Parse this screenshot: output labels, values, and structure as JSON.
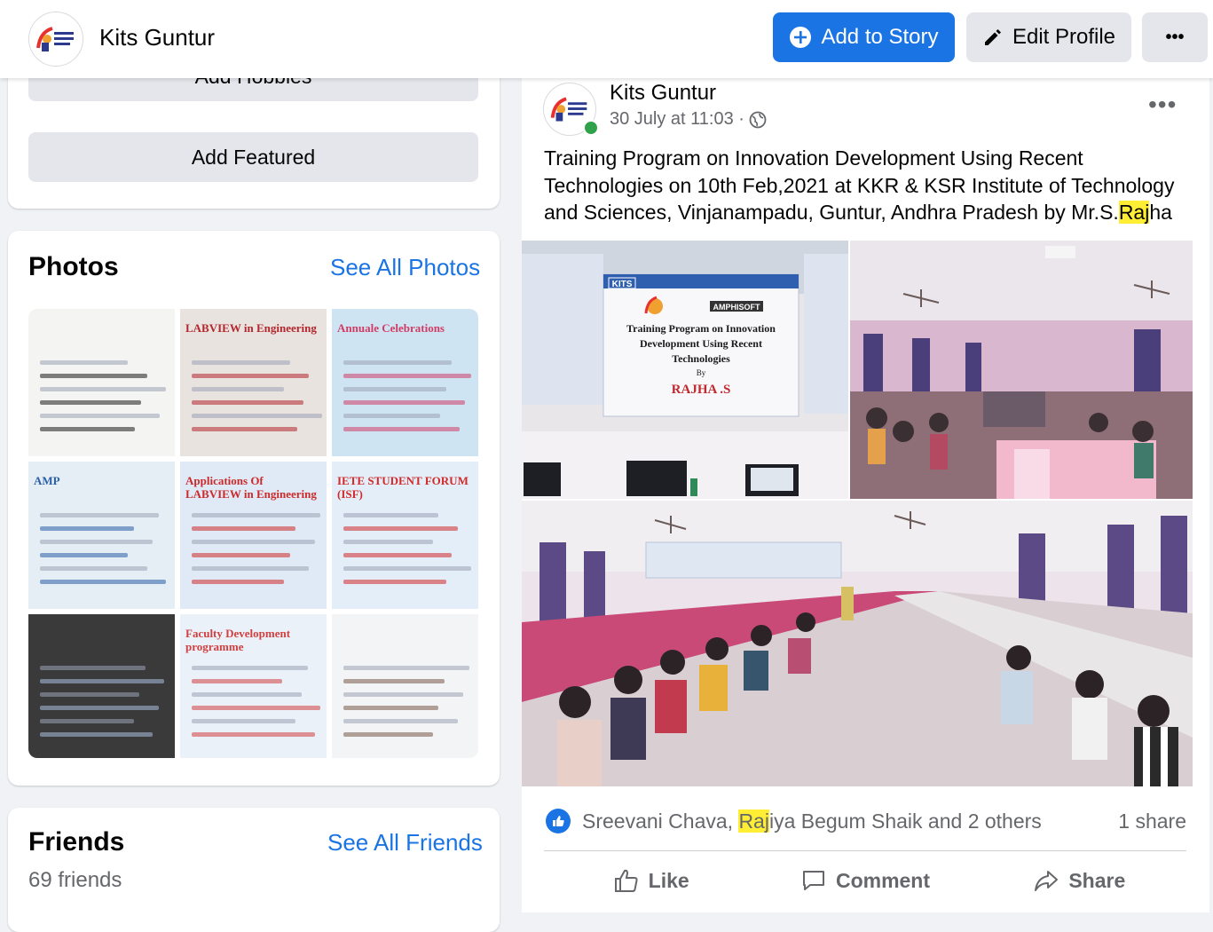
{
  "topbar": {
    "page_name": "Kits Guntur",
    "add_to_story_label": "Add to Story",
    "edit_profile_label": "Edit Profile",
    "more_label": "•••"
  },
  "intro": {
    "add_hobbies_label": "Add Hobbies",
    "add_featured_label": "Add Featured"
  },
  "photos": {
    "title": "Photos",
    "see_all_label": "See All Photos",
    "thumbnails": [
      {
        "text": "",
        "bg": "#f4f4f2",
        "accent": "#1c1c1c"
      },
      {
        "text": "LABVIEW in Engineering",
        "bg": "#e9e3df",
        "accent": "#b3262d"
      },
      {
        "text": "Annuale Celebrations",
        "bg": "#cfe4f3",
        "accent": "#d03c64"
      },
      {
        "text": "AMP",
        "bg": "#e6eef5",
        "accent": "#2a5fa8"
      },
      {
        "text": "Applications Of LABVIEW in Engineering",
        "bg": "#dfeaf6",
        "accent": "#cc2a2a"
      },
      {
        "text": "IETE STUDENT FORUM (ISF)",
        "bg": "#e4eef8",
        "accent": "#d02a2a"
      },
      {
        "text": "",
        "bg": "#3a3a3a",
        "accent": "#a9bfe0"
      },
      {
        "text": "Faculty Development programme",
        "bg": "#eaf1f8",
        "accent": "#d04040"
      },
      {
        "text": "",
        "bg": "#f2f4f6",
        "accent": "#7a5a48"
      }
    ]
  },
  "friends": {
    "title": "Friends",
    "see_all_label": "See All Friends",
    "count_text": "69 friends"
  },
  "post": {
    "author": "Kits Guntur",
    "timestamp": "30 July at 11:03 ·",
    "more_label": "•••",
    "text_before": "Training Program on Innovation Development Using Recent Technologies on 10th Feb,2021 at KKR & KSR Institute of Technology and Sciences, Vinjanampadu, Guntur, Andhra Pradesh by Mr.S.",
    "text_highlight": "Raj",
    "text_after": "ha",
    "banner": {
      "kits": "KITS",
      "amphisoft": "AMPHISOFT",
      "line1": "Training Program on Innovation",
      "line2": "Development Using Recent",
      "line3": "Technologies",
      "by": "By",
      "name": "RAJHA .S"
    },
    "reactions": {
      "text_before": "Sreevani Chava, ",
      "text_highlight": "Raj",
      "text_after": "iya Begum Shaik and 2 others",
      "share_count": "1 share"
    },
    "actions": {
      "like_label": "Like",
      "comment_label": "Comment",
      "share_label": "Share"
    }
  },
  "colors": {
    "accent": "#1b74e4",
    "highlight": "#ffee33",
    "online": "#31a24c"
  }
}
